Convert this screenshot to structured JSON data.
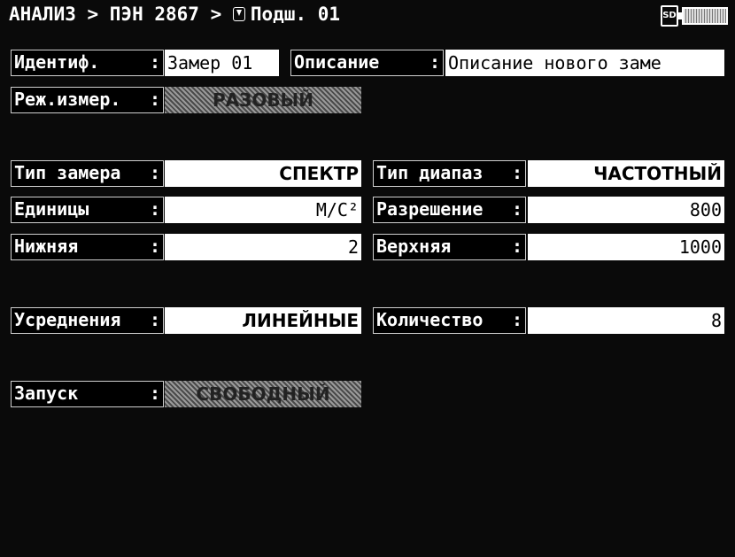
{
  "header": {
    "breadcrumb_part1": "АНАЛИЗ > ПЭН 2867 > ",
    "breadcrumb_part2": "Подш. 01",
    "sd_label": "SD"
  },
  "form": {
    "ident_label": "Идентиф.",
    "ident_value": "Замер 01",
    "desc_label": "Описание",
    "desc_value": "Описание нового заме",
    "mode_label": "Реж.измер.",
    "mode_value": "РАЗОВЫЙ",
    "type_label": "Тип замера",
    "type_value": "СПЕКТР",
    "range_label": "Тип диапаз",
    "range_value": "ЧАСТОТНЫЙ",
    "units_label": "Единицы",
    "units_value": "М/С²",
    "resolution_label": "Разрешение",
    "resolution_value": "800",
    "lower_label": "Нижняя",
    "lower_value": "2",
    "upper_label": "Верхняя",
    "upper_value": "1000",
    "avg_label": "Усреднения",
    "avg_value": "ЛИНЕЙНЫЕ",
    "count_label": "Количество",
    "count_value": "8",
    "trigger_label": "Запуск",
    "trigger_value": "СВОБОДНЫЙ",
    "colon": ":"
  }
}
